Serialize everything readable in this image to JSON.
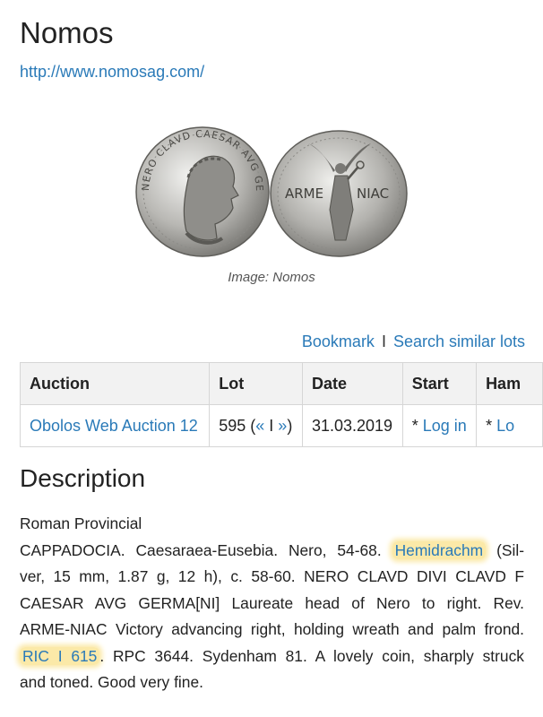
{
  "page": {
    "title": "Nomos",
    "url": "http://www.nomosag.com/"
  },
  "image": {
    "caption": "Image: Nomos",
    "obverse_legend": "NERO CLAVD CAESAR AVG GERMAN",
    "reverse_left": "ARME",
    "reverse_right": "NIAC"
  },
  "actions": {
    "bookmark": "Bookmark",
    "separator": "I",
    "search_similar": "Search similar lots"
  },
  "table": {
    "headers": [
      "Auction",
      "Lot",
      "Date",
      "Start",
      "Ham"
    ],
    "row": {
      "auction": "Obolos Web Auction 12",
      "lot_number": "595 (",
      "lot_prev": "«",
      "lot_sep": " I ",
      "lot_next": "»",
      "lot_close": ")",
      "date": "31.03.2019",
      "start_prefix": "* ",
      "start_link": "Log in",
      "hammer_prefix": "* ",
      "hammer_link": "Lo"
    }
  },
  "description": {
    "heading": "Description",
    "category": "Roman Provincial",
    "line1_pre": "CAPPADOCIA. Caesaraea-Eusebia. Nero, 54-68. ",
    "line1_highlight": "Hemidrachm",
    "line1_post": " (Sil-",
    "line2": "ver, 15 mm, 1.87 g, 12 h), c. 58-60. NERO CLAVD DIVI CLAVD F",
    "line3": "CAESAR AVG GERMA[NI] Laureate head of Nero to right. Rev.",
    "line4": "ARME-NIAC Victory advancing right, holding wreath and palm frond.",
    "line5_highlight": "RIC I 615",
    "line5_post": ". RPC 3644. Sydenham 81. A lovely coin, sharply struck",
    "line6": "and toned. Good very fine."
  },
  "colors": {
    "link": "#2a7ab8",
    "highlight": "#fbe9a8",
    "header_bg": "#f2f2f2"
  }
}
